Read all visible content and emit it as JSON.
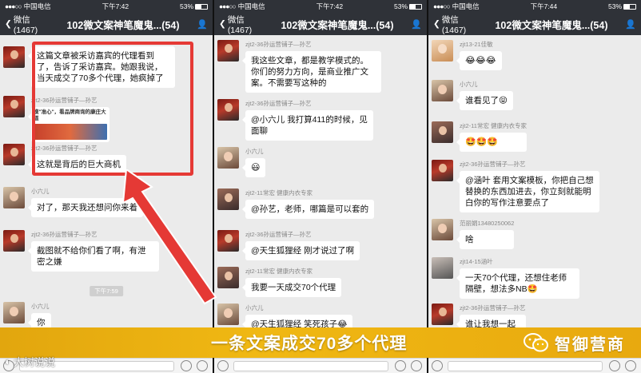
{
  "phones": [
    {
      "status": {
        "carrier": "中国电信",
        "time": "下午7:42",
        "battery": "53%"
      },
      "nav": {
        "back": "微信(1467)",
        "title": "102微文案神笔魔鬼...(54)"
      },
      "messages": [
        {
          "name": "",
          "text": "这篇文章被采访嘉宾的代理看到了，告诉了采访嘉宾。她跟我说，当天成交了70多个代理，她疯掉了"
        },
        {
          "name": "zjt2-36孙运营铺子—孙艺",
          "image_title": "摸\"准心\"，看品牌商询的康庄大道"
        },
        {
          "name": "zjt2-36孙运营铺子—孙艺",
          "text": "这就是背后的巨大商机"
        },
        {
          "name": "小六儿",
          "text": "对了，那天我还想问你来着"
        },
        {
          "name": "zjt2-36孙运营铺子—孙艺",
          "text": "截图就不给你们看了啊，有泄密之嫌"
        },
        {
          "name": "小六儿",
          "text": "你"
        }
      ],
      "timestamp": "下午7:59"
    },
    {
      "status": {
        "carrier": "中国电信",
        "time": "下午7:42",
        "battery": "53%"
      },
      "nav": {
        "back": "微信(1467)",
        "title": "102微文案神笔魔鬼...(54)"
      },
      "messages": [
        {
          "name": "zjt2-36孙运营铺子—孙艺",
          "text": "我这些文章，都是教学模式的。你们的努力方向，是商业推广文案。不需要写这种的"
        },
        {
          "name": "zjt2-36孙运营铺子—孙艺",
          "text": "@小六儿 我打算411的时候，见面聊"
        },
        {
          "name": "小六儿",
          "text": "😃"
        },
        {
          "name": "zjt2-11常宏  健康内衣专家",
          "text": "@孙艺，老师，哪篇是可以套的"
        },
        {
          "name": "zjt2-36孙运营铺子—孙艺",
          "text": "@天生狐狸经 刚才说过了啊"
        },
        {
          "name": "zjt2-11常宏  健康内衣专家",
          "text": "我要一天成交70个代理"
        },
        {
          "name": "小六儿",
          "text": "@天生狐狸经 笑死孩子😂"
        }
      ]
    },
    {
      "status": {
        "carrier": "中国电信",
        "time": "下午7:44",
        "battery": "53%"
      },
      "nav": {
        "back": "微信(1467)",
        "title": "102微文案神笔魔鬼...(54)"
      },
      "messages": [
        {
          "name": "zjt13-21佳敏",
          "text": "😂😂😂"
        },
        {
          "name": "小六儿",
          "text": "谁看见了😝"
        },
        {
          "name": "zjt2-11常宏  健康内衣专家",
          "text": "🤩🤩🤩"
        },
        {
          "name": "zjt2-36孙运营铺子—孙艺",
          "text": "@涵叶 套用文案模板，你把自己想替换的东西加进去，你立刻就能明白你的写作注意要点了"
        },
        {
          "name": "范丽娟13480250062",
          "text": "啥"
        },
        {
          "name": "zjt14-15涵叶",
          "text": "一天70个代理，还想住老师隔壁，想法多NB🤩"
        },
        {
          "name": "zjt2-36孙运营铺子—孙艺",
          "text": "谁让我想一起"
        }
      ]
    }
  ],
  "banner": {
    "caption": "一条文案成交70多个代理",
    "brand": "智御营商"
  },
  "watermark": "大树说说",
  "colors": {
    "highlight_red": "#e53935",
    "banner_gold": "#f0b813",
    "nav_dark": "#2f3238"
  },
  "icons": [
    "back-chevron-icon",
    "group-people-icon",
    "wechat-logo-icon",
    "voice-icon",
    "emoji-icon",
    "plus-icon"
  ]
}
